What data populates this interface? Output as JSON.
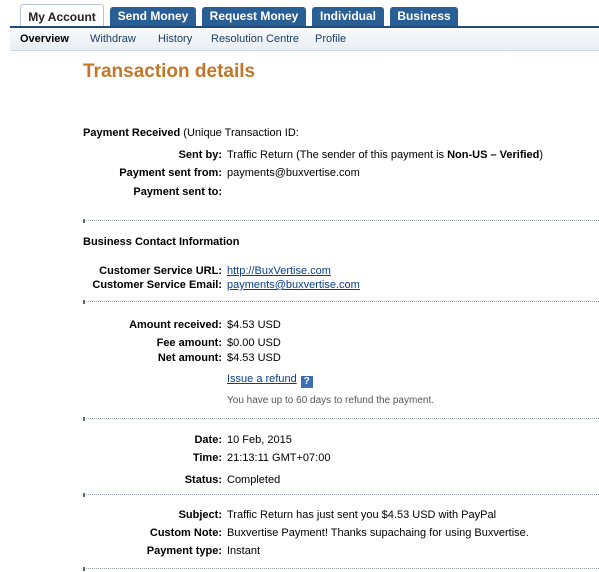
{
  "tabs": {
    "my_account": "My Account",
    "send_money": "Send Money",
    "request_money": "Request Money",
    "individual": "Individual",
    "business": "Business"
  },
  "subnav": {
    "overview": "Overview",
    "withdraw": "Withdraw",
    "history": "History",
    "resolution": "Resolution Centre",
    "profile": "Profile"
  },
  "page_title": "Transaction details",
  "payment_received": {
    "bold": "Payment Received",
    "rest": "(Unique Transaction ID:"
  },
  "sender": {
    "sent_by_label": "Sent by:",
    "sent_by_value": "Traffic Return (The sender of this payment is ",
    "sent_by_status": "Non-US – Verified",
    "sent_by_close": ")",
    "sent_from_label": "Payment sent from:",
    "sent_from_value": "payments@buxvertise.com",
    "sent_to_label": "Payment sent to:"
  },
  "business_contact": {
    "heading": "Business Contact Information",
    "url_label": "Customer Service URL:",
    "url_value": "http://BuxVertise.com",
    "email_label": "Customer Service Email:",
    "email_value": "payments@buxvertise.com"
  },
  "amounts": {
    "received_label": "Amount received:",
    "received_value": "$4.53 USD",
    "fee_label": "Fee amount:",
    "fee_value": "$0.00 USD",
    "net_label": "Net amount:",
    "net_value": "$4.53 USD",
    "refund_link": "Issue a refund",
    "help_icon": "?",
    "refund_note": "You have up to 60 days to refund the payment."
  },
  "timing": {
    "date_label": "Date:",
    "date_value": "10 Feb, 2015",
    "time_label": "Time:",
    "time_value": "21:13:11 GMT+07:00",
    "status_label": "Status:",
    "status_value": "Completed"
  },
  "message": {
    "subject_label": "Subject:",
    "subject_value": "Traffic Return has just sent you $4.53 USD with PayPal",
    "note_label": "Custom Note:",
    "note_value": "Buxvertise Payment! Thanks supachaing for using Buxvertise.",
    "type_label": "Payment type:",
    "type_value": "Instant"
  },
  "colors": {
    "tab_bg": "#2a5f95",
    "title": "#c0772b",
    "link": "#0b3f87"
  }
}
